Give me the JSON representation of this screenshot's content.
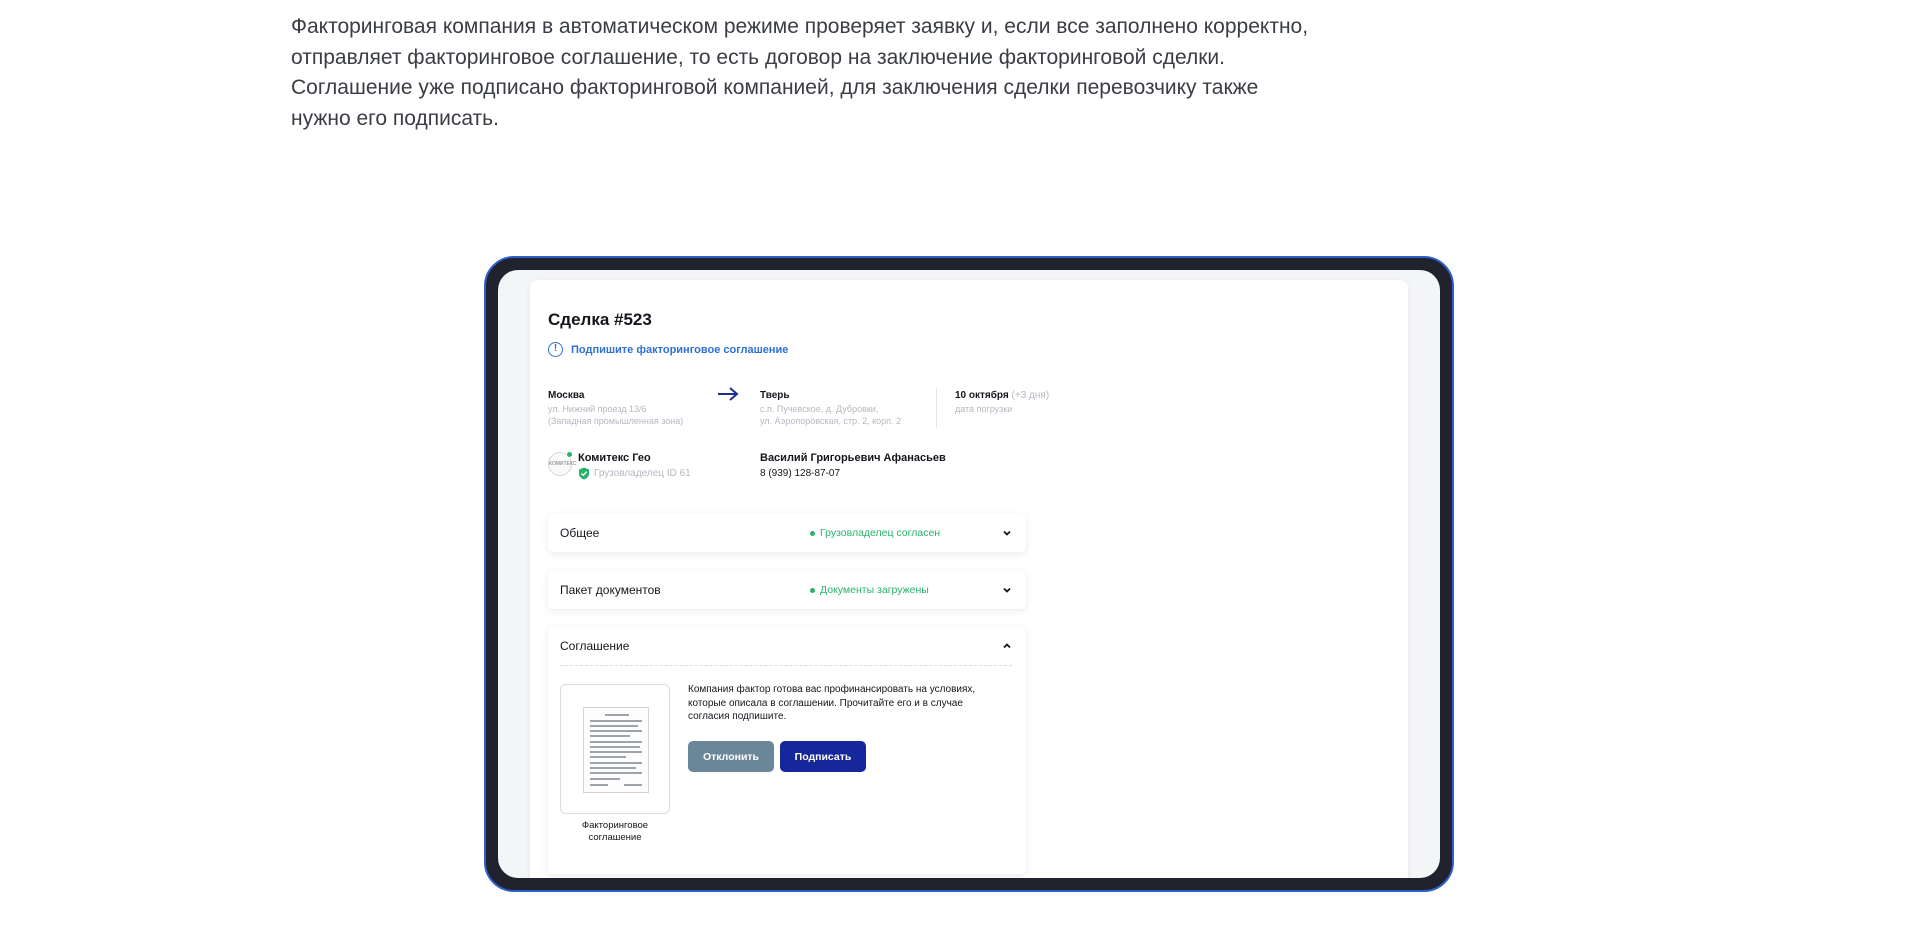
{
  "intro": {
    "lines": [
      "Факторинговая компания в автоматическом режиме проверяет заявку и, если все заполнено корректно,",
      "отправляет факторинговое соглашение, то есть договор на заключение факторинговой сделки.",
      "Соглашение уже подписано факторинговой компанией, для заключения сделки перевозчику также",
      "нужно его подписать."
    ]
  },
  "deal": {
    "title": "Сделка #523",
    "notice": "Подпишите факторинговое соглашение",
    "route": {
      "from_city": "Москва",
      "from_addr_1": "ул. Нижний проезд 13/6",
      "from_addr_2": "(Западная промышленная зона)",
      "to_city": "Тверь",
      "to_addr_1": "с.п. Пучевское, д. Дубровки,",
      "to_addr_2": "ул. Аэропоровская, стр. 2, корп. 2",
      "date": "10 октября",
      "date_extra": "(+3 дня)",
      "date_label": "дата погрузки"
    },
    "company": {
      "logo_text": "КОМИТЕКС",
      "name": "Комитекс Гео",
      "role": "Грузовладелец ID 61"
    },
    "contact": {
      "name": "Василий Григорьевич Афанасьев",
      "phone": "8 (939) 128-87-07"
    },
    "panels": {
      "general": {
        "title": "Общее",
        "status": "Грузовладелец согласен"
      },
      "documents": {
        "title": "Пакет документов",
        "status": "Документы загружены"
      },
      "agreement": {
        "title": "Соглашение",
        "doc_caption_1": "Факторинговое",
        "doc_caption_2": "соглашение",
        "text": "Компания фактор готова вас профинансировать на условиях, которые описала в соглашении. Прочитайте его и в случае согласия подпишите.",
        "reject_label": "Отклонить",
        "sign_label": "Подписать"
      }
    }
  },
  "colors": {
    "accent_blue": "#2f6fd6",
    "success_green": "#27b36a",
    "sign_button": "#15279a",
    "reject_button": "#6b8599",
    "device_frame": "#20222e",
    "device_border": "#2f5fc9"
  },
  "icons": [
    "info-icon",
    "arrow-right-icon",
    "shield-check-icon",
    "chevron-down-icon",
    "chevron-up-icon",
    "document-icon"
  ]
}
